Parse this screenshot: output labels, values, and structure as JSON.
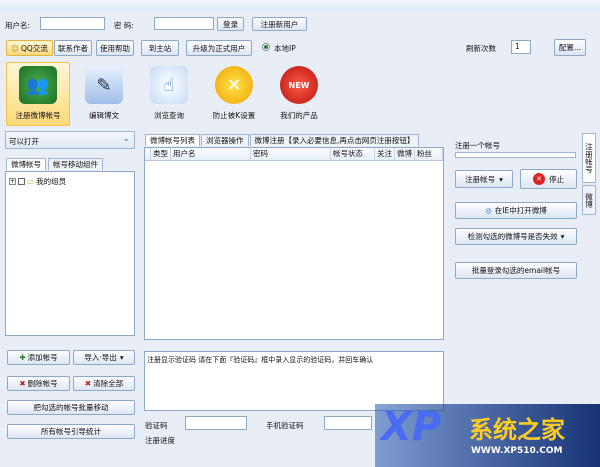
{
  "login": {
    "username_label": "用户名:",
    "password_label": "密  码:",
    "login_button": "登录",
    "register_button": "注册新用户"
  },
  "menu": {
    "qq_label": "QQ交流",
    "contact": "联系作者",
    "help": "使用帮助",
    "site": "到主站",
    "upgrade": "升级为正式用户",
    "local_label": "本地IP",
    "retry_label": "刷新次数",
    "retry_value": "1",
    "config": "配置..."
  },
  "toolbar": [
    {
      "name": "register-weibo-account",
      "label": "注册微博帐号",
      "icon": "user-pair-icon"
    },
    {
      "name": "edit-weibo",
      "label": "编辑博文",
      "icon": "notepad-icon"
    },
    {
      "name": "browse-query",
      "label": "浏览查询",
      "icon": "pointer-hand-icon"
    },
    {
      "name": "anti-block-settings",
      "label": "防止被K设置",
      "icon": "wrench-icon"
    },
    {
      "name": "new-products",
      "label": "我们的产品",
      "icon": "new-badge-icon"
    }
  ],
  "left": {
    "open_label": "可以打开",
    "tabs": [
      "微博帐号",
      "帐号移动组件"
    ],
    "tree_root": "我的组员",
    "buttons": [
      "添加帐号",
      "导入·导出",
      "删除帐号",
      "清除全部",
      "把勾选的帐号批量移动",
      "所有帐号引导统计"
    ]
  },
  "center": {
    "tabs": [
      "微博帐号列表",
      "浏览器操作",
      "微博注册【录入必要信息,再点击网页注册按钮】"
    ],
    "columns": [
      "类型",
      "用户名",
      "密码",
      "帐号状态",
      "关注",
      "微博",
      "粉丝"
    ],
    "captcha_hint": "注册显示验证码 请在下面『验证码』框中录入显示的验证码，并回车确认",
    "captcha_label": "验证码",
    "phone_label": "手机验证码",
    "progress_label": "注册进度"
  },
  "right": {
    "title": "注册一个帐号",
    "register_btn": "注册帐号",
    "stop_btn": "停止",
    "open_in_browser": "在IE中打开微博",
    "check_btn": "检测勾选的微博号是否失效",
    "batch_login": "批量登录勾选的email帐号",
    "vtabs": [
      "注册帐号",
      "微博"
    ]
  },
  "watermark": {
    "brand": "系统之家",
    "url": "WWW.XP510.COM"
  }
}
